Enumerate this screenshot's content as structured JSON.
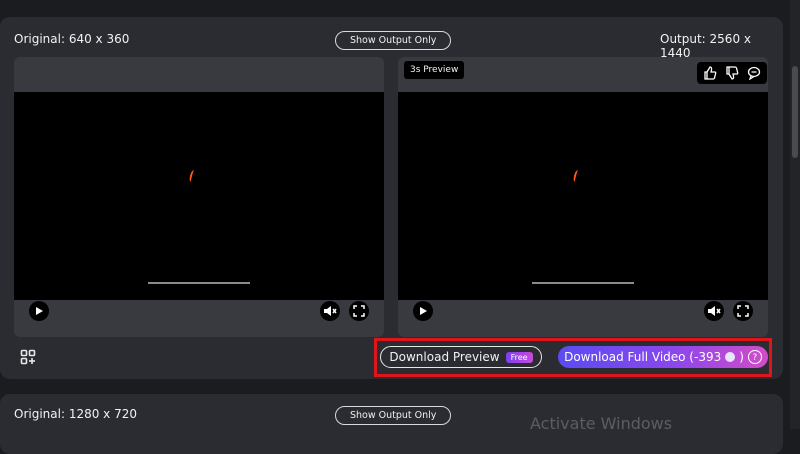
{
  "top_card": {
    "original_label": "Original: 640 x 360",
    "show_output_only_label": "Show Output Only",
    "output_label": "Output: 2560 x 1440",
    "preview_badge": "3s Preview",
    "download_preview_label": "Download Preview",
    "free_badge": "Free",
    "download_full_label": "Download Full Video (-393",
    "download_full_suffix": ")",
    "help_glyph": "?"
  },
  "bottom_card": {
    "original_label": "Original: 1280 x 720",
    "show_output_only_label": "Show Output Only"
  },
  "icons": {
    "play": "play-icon",
    "mute": "mute-icon",
    "fullscreen": "fullscreen-icon",
    "thumbs_up": "thumbs-up-icon",
    "thumbs_down": "thumbs-down-icon",
    "comment": "comment-icon",
    "grid": "grid-icon",
    "coin": "coin-icon",
    "help": "help-icon"
  },
  "colors": {
    "accent_start": "#5a4cf2",
    "accent_end": "#d24cc8",
    "highlight_frame": "#e0141b"
  },
  "watermark_text": "Activate Windows"
}
